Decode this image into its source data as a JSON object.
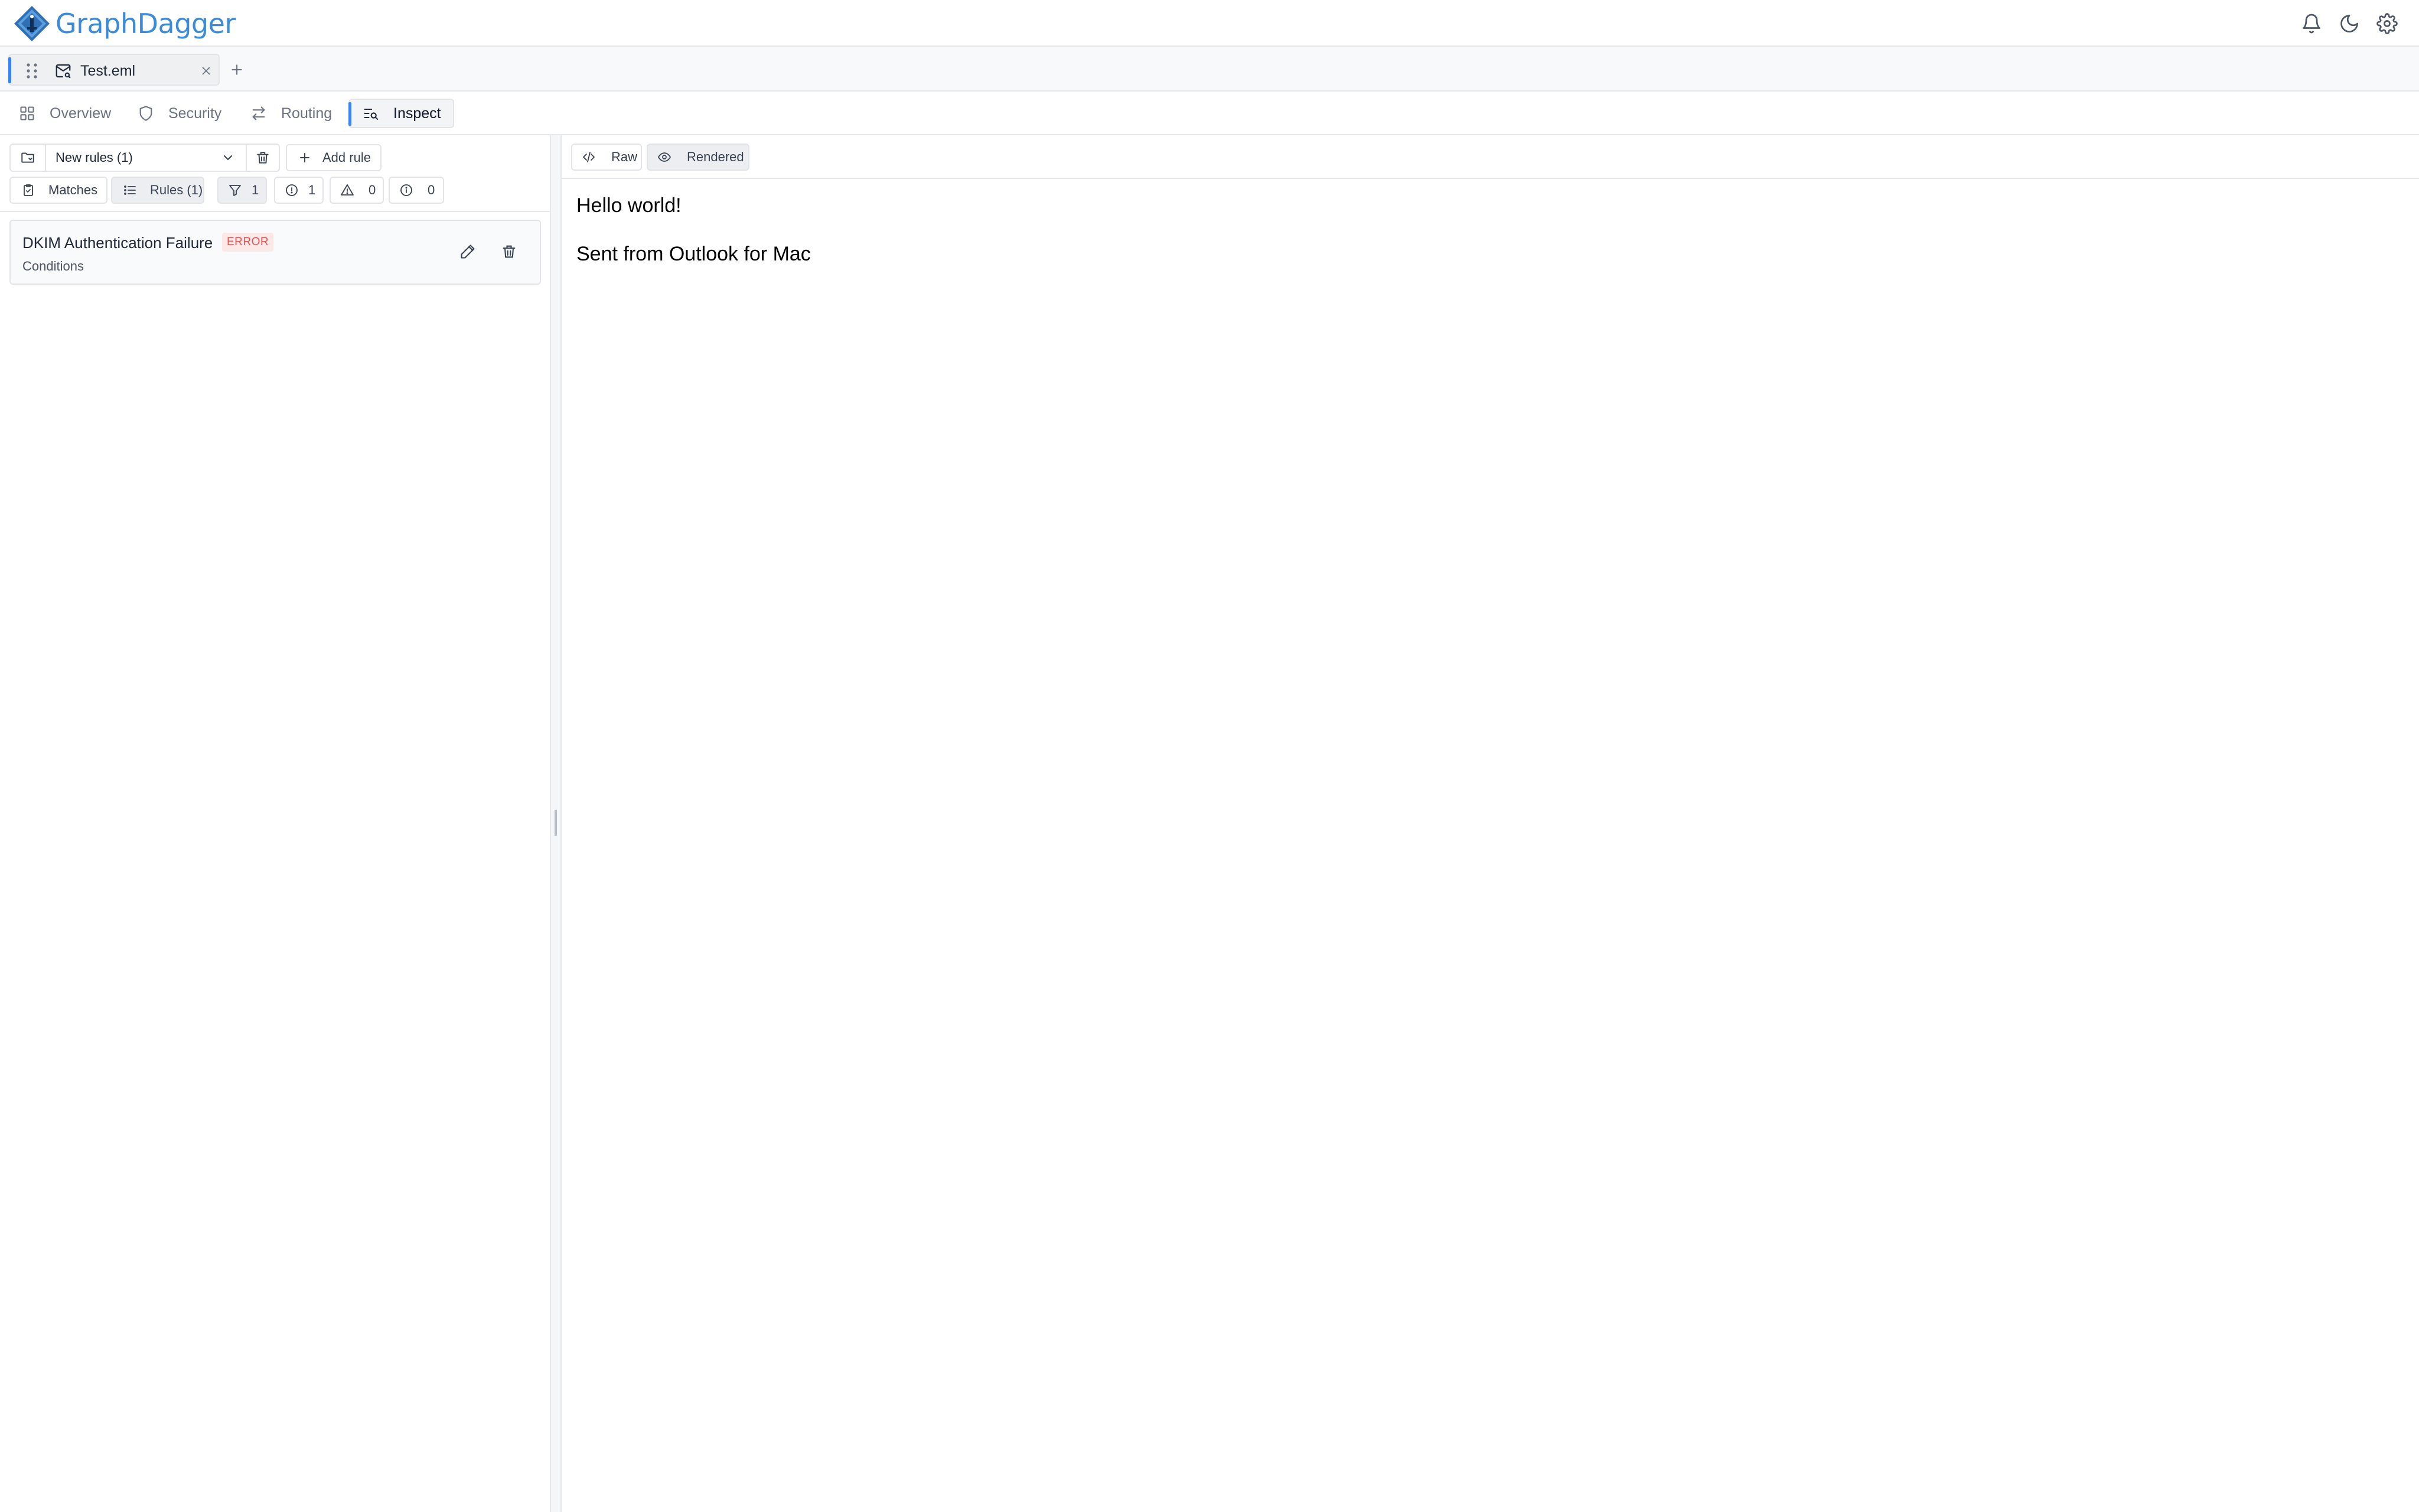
{
  "app": {
    "name": "GraphDagger"
  },
  "file_tabs": [
    {
      "name": "Test.eml"
    }
  ],
  "nav_tabs": [
    {
      "label": "Overview",
      "icon": "layout-grid-icon"
    },
    {
      "label": "Security",
      "icon": "shield-icon"
    },
    {
      "label": "Routing",
      "icon": "arrows-swap-icon"
    },
    {
      "label": "Inspect",
      "icon": "text-search-icon",
      "active": true
    }
  ],
  "rules_panel": {
    "ruleset_select": {
      "value": "New rules (1)"
    },
    "add_rule_label": "Add rule",
    "view_tabs": [
      {
        "label": "Matches"
      },
      {
        "label": "Rules (1)",
        "selected": true
      }
    ],
    "filters": [
      {
        "icon": "filter-icon",
        "count": "1",
        "selected": true
      },
      {
        "icon": "error-circle-icon",
        "count": "1"
      },
      {
        "icon": "warning-triangle-icon",
        "count": "0"
      },
      {
        "icon": "info-circle-icon",
        "count": "0"
      }
    ],
    "rules": [
      {
        "title": "DKIM Authentication Failure",
        "severity": "ERROR",
        "subtitle": "Conditions"
      }
    ]
  },
  "viewer": {
    "modes": [
      {
        "label": "Raw"
      },
      {
        "label": "Rendered",
        "selected": true
      }
    ],
    "content": {
      "line1": "Hello world!",
      "line2": "Sent from Outlook for Mac"
    }
  },
  "colors": {
    "brand": "#3b8bd6",
    "accent": "#3b82f6",
    "error_text": "#e25555",
    "error_bg": "#fde8e8"
  }
}
